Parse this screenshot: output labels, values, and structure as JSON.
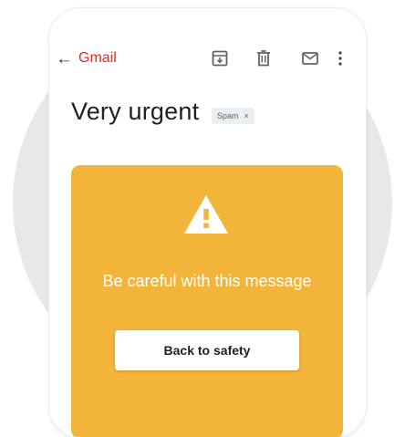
{
  "header": {
    "back_arrow": "←",
    "app_name": "Gmail",
    "actions": [
      {
        "icon": "archive-icon"
      },
      {
        "icon": "delete-icon"
      },
      {
        "icon": "mark-unread-icon"
      },
      {
        "icon": "more-vert-icon"
      }
    ]
  },
  "message": {
    "subject": "Very urgent",
    "label": "Spam",
    "label_remove": "×"
  },
  "warning": {
    "icon": "warning-triangle-icon",
    "title": "Be careful with this message",
    "button_label": "Back to safety"
  },
  "colors": {
    "brand_red": "#d93025",
    "warning_yellow": "#f2b53a",
    "text_dark": "#202124",
    "icon_gray": "#5f6368"
  }
}
